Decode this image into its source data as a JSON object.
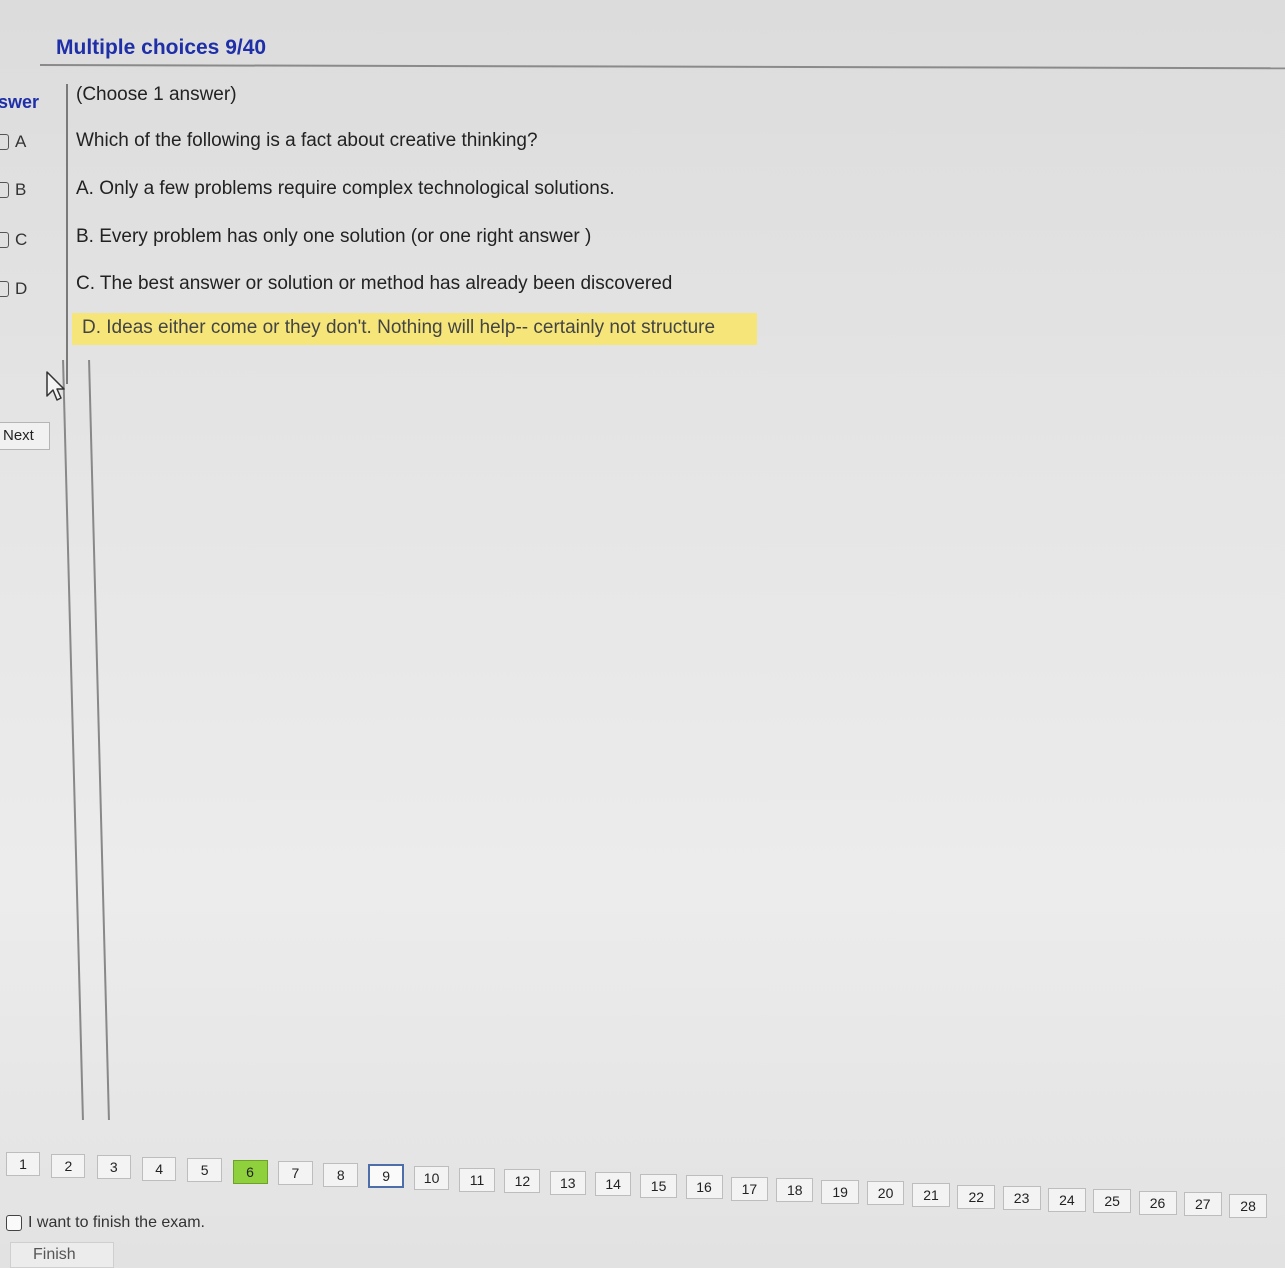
{
  "header": {
    "title": "Multiple choices 9/40"
  },
  "answer_panel": {
    "heading": "swer",
    "options": [
      "A",
      "B",
      "C",
      "D"
    ],
    "next_label": "Next"
  },
  "question": {
    "instruction": "(Choose 1 answer)",
    "text": "Which of the following is a fact about creative thinking?",
    "choices": [
      "A.  Only a few problems require complex technological solutions.",
      "B.  Every problem has only one solution (or one right answer )",
      "C.  The best answer or solution or method has already been discovered",
      "D.  Ideas either come or they don't. Nothing will help-- certainly not structure"
    ],
    "highlighted_choice": "D"
  },
  "pager": {
    "pages": [
      "1",
      "2",
      "3",
      "4",
      "5",
      "6",
      "7",
      "8",
      "9",
      "10",
      "11",
      "12",
      "13",
      "14",
      "15",
      "16",
      "17",
      "18",
      "19",
      "20",
      "21",
      "22",
      "23",
      "24",
      "25",
      "26",
      "27",
      "28"
    ],
    "answered": [
      "6"
    ],
    "current": "9",
    "colors": {
      "answered": "#8fd13c",
      "current_border": "#4d6ea8"
    }
  },
  "finish": {
    "checkbox_label": "I want to finish the exam.",
    "button_label": "Finish"
  }
}
